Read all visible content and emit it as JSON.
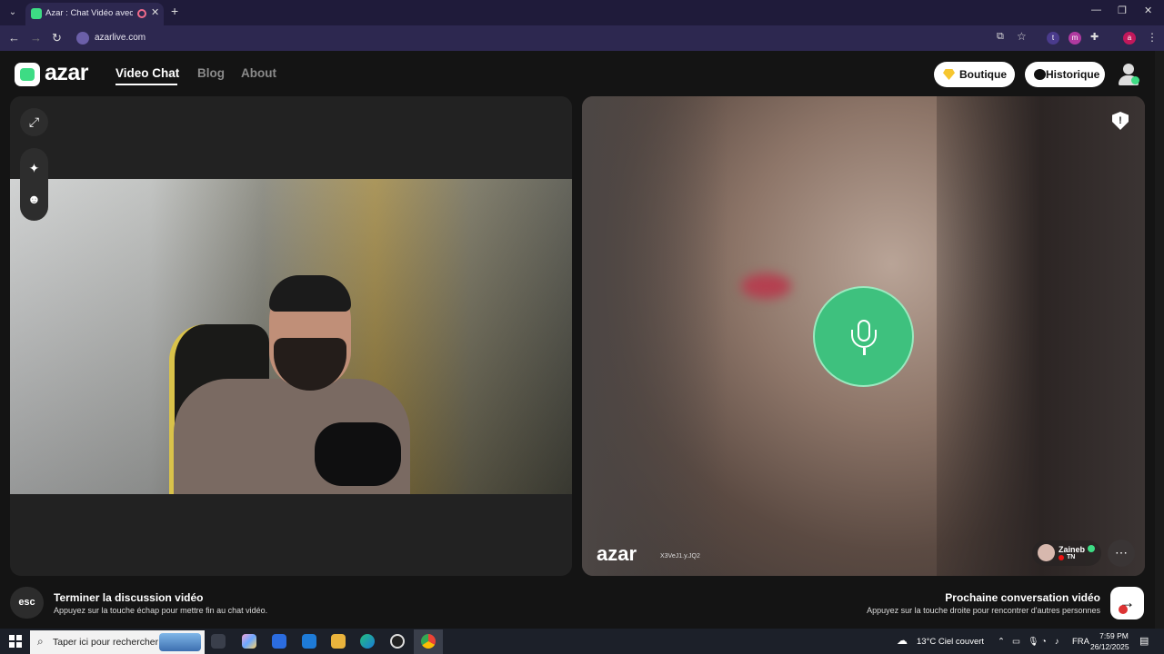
{
  "browser": {
    "tab_title": "Azar : Chat Vidéo avec de n",
    "url": "azarlive.com",
    "extensions": [
      "t",
      "m",
      "a"
    ]
  },
  "site": {
    "logo_text": "azar",
    "nav": [
      "Video Chat",
      "Blog",
      "About"
    ],
    "boutique_label": "Boutique",
    "historique_label": "Historique"
  },
  "remote": {
    "watermark": "azar",
    "watermark_code": "X3VeJ1.y.JQ2",
    "peer_name": "Zaineb",
    "peer_country": "TN"
  },
  "bottom": {
    "esc_label": "esc",
    "end_title": "Terminer la discussion vidéo",
    "end_sub": "Appuyez sur la touche échap pour mettre fin au chat vidéo.",
    "next_title": "Prochaine conversation vidéo",
    "next_sub": "Appuyez sur la touche droite pour rencontrer d'autres personnes"
  },
  "taskbar": {
    "search_placeholder": "Taper ici pour rechercher",
    "weather": "13°C  Ciel couvert",
    "lang": "FRA",
    "time": "7:59 PM",
    "date": "26/12/2025"
  },
  "colors": {
    "accent_green": "#3ddc84",
    "mic_green": "#3ec17e"
  }
}
